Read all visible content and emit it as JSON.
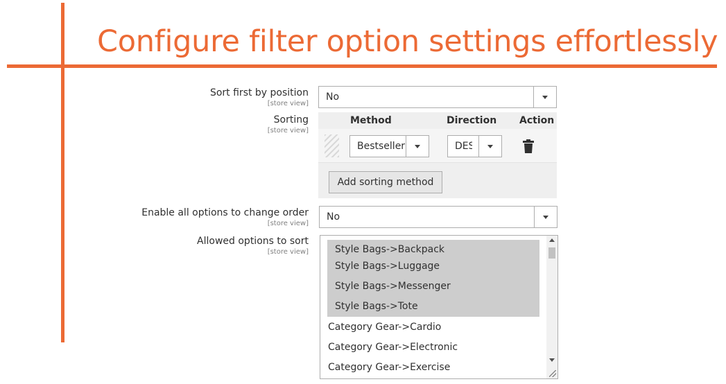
{
  "hero": {
    "title": "Configure filter option settings effortlessly"
  },
  "sort_first": {
    "label": "Sort first by position",
    "scope": "[store view]",
    "value": "No"
  },
  "sorting": {
    "label": "Sorting",
    "scope": "[store view]",
    "headers": {
      "method": "Method",
      "direction": "Direction",
      "action": "Action"
    },
    "rows": [
      {
        "method": "Bestseller",
        "direction": "DESC"
      }
    ],
    "add_button": "Add sorting method"
  },
  "enable_all": {
    "label": "Enable all options to change order",
    "scope": "[store view]",
    "value": "No"
  },
  "allowed": {
    "label": "Allowed options to sort",
    "scope": "[store view]",
    "options": [
      "Style Bags->Backpack",
      "Style Bags->Luggage",
      "Style Bags->Messenger",
      "Style Bags->Tote",
      "Category Gear->Cardio",
      "Category Gear->Electronic",
      "Category Gear->Exercise"
    ]
  },
  "colors": {
    "accent": "#ec6a35"
  },
  "icons": {
    "dropdown": "chevron-down-icon",
    "delete": "trash-icon",
    "drag": "drag-handle-icon"
  }
}
